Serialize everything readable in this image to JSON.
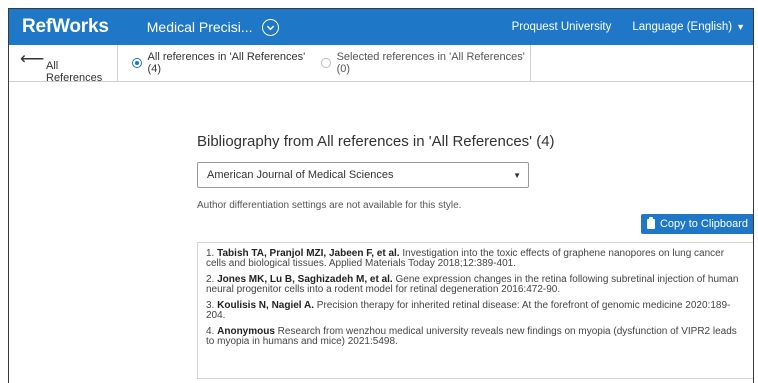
{
  "topbar": {
    "logo": "RefWorks",
    "project_title": "Medical Precisi...",
    "institution": "Proquest University",
    "language": "Language (English)",
    "language_caret": "▼"
  },
  "subbar": {
    "back_label": "All References",
    "back_icon": "left-arrow-icon",
    "radio_all": "All references in 'All References' (4)",
    "radio_selected": "Selected references in 'All References' (0)",
    "radio_all_checked": true
  },
  "main": {
    "heading": "Bibliography from All references in 'All References' (4)",
    "style_select": {
      "value": "American Journal of Medical Sciences",
      "caret": "▼"
    },
    "note": "Author differentiation settings are not available for this style.",
    "copy_button": "Copy to Clipboard"
  },
  "bibliography": [
    {
      "num": "1.",
      "authors": "Tabish TA, Pranjol MZI, Jabeen F, et al.",
      "text": " Investigation into the toxic effects of graphene nanopores on lung cancer cells and biological tissues. Applied Materials Today 2018;12:389-401."
    },
    {
      "num": "2.",
      "authors": "Jones MK, Lu B, Saghizadeh M, et al.",
      "text": " Gene expression changes in the retina following subretinal injection of human neural progenitor cells into a rodent model for retinal degeneration 2016:472-90."
    },
    {
      "num": "3.",
      "authors": "Koulisis N, Nagiel A.",
      "text": " Precision therapy for inherited retinal disease: At the forefront of genomic medicine 2020:189-204."
    },
    {
      "num": "4.",
      "authors": "Anonymous",
      "text": " Research from wenzhou medical university reveals new findings on myopia (dysfunction of VIPR2 leads to myopia in humans and mice) 2021:5498."
    }
  ],
  "colors": {
    "brand": "#1f77c8",
    "border": "#cfcfcf"
  }
}
